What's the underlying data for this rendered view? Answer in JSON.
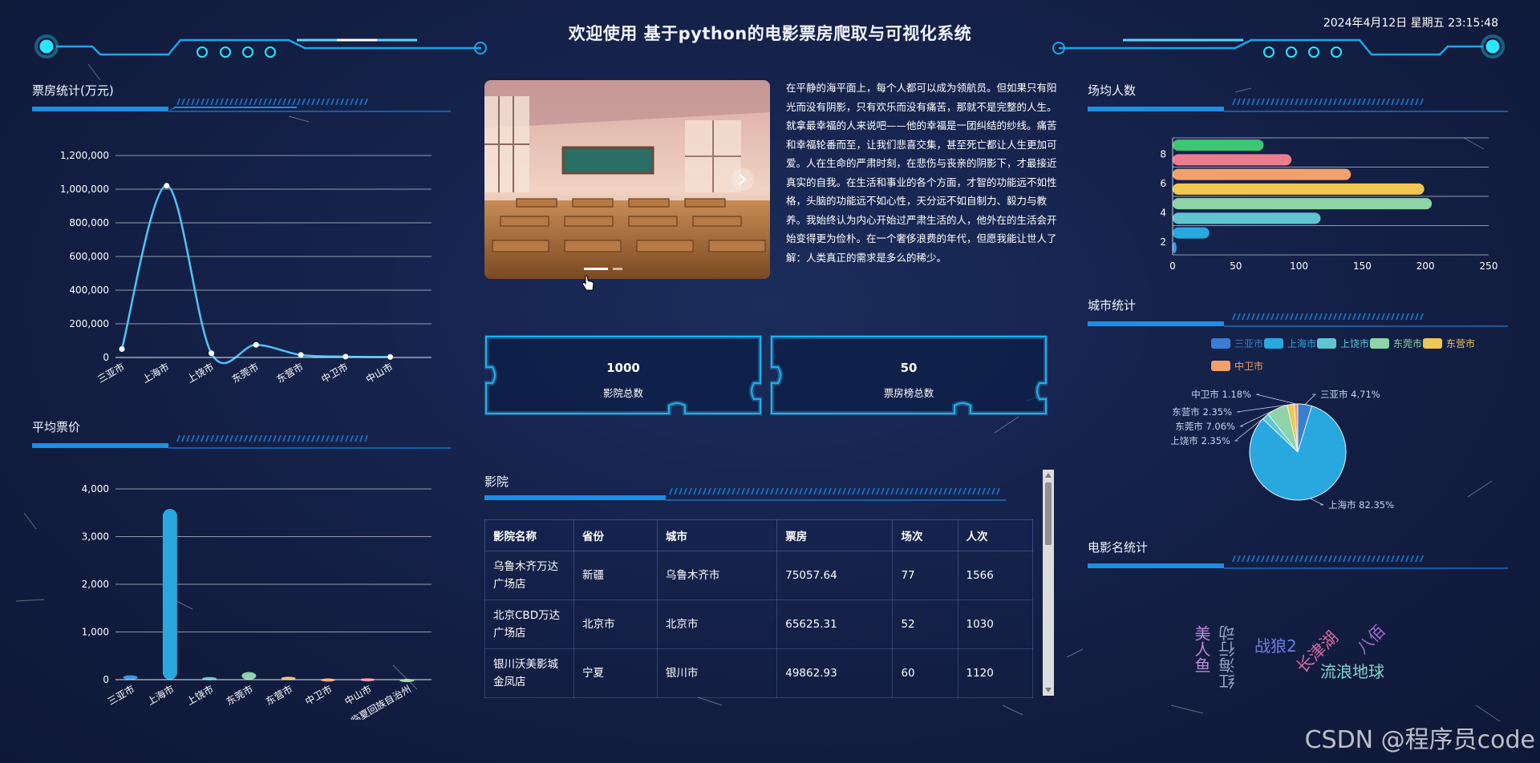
{
  "header": {
    "title": "欢迎使用 基于python的电影票房爬取与可视化系统",
    "datetime": "2024年4月12日 星期五 23:15:48"
  },
  "panels": {
    "box_office": {
      "title": "票房统计(万元)"
    },
    "avg_price": {
      "title": "平均票价"
    },
    "avg_attendance": {
      "title": "场均人数"
    },
    "city_stats": {
      "title": "城市统计"
    },
    "movie_names": {
      "title": "电影名统计"
    },
    "cinema": {
      "title": "影院"
    }
  },
  "intro_text": "在平静的海平面上，每个人都可以成为领航员。但如果只有阳光而没有阴影，只有欢乐而没有痛苦，那就不是完整的人生。就拿最幸福的人来说吧——他的幸福是一团纠结的纱线。痛苦和幸福轮番而至，让我们悲喜交集，甚至死亡都让人生更加可爱。人在生命的严肃时刻，在悲伤与丧亲的阴影下，才最接近真实的自我。在生活和事业的各个方面，才智的功能远不如性格，头脑的功能远不如心性，天分远不如自制力、毅力与教养。我始终认为内心开始过严肃生活的人，他外在的生活会开始变得更为俭朴。在一个奢侈浪费的年代，但愿我能让世人了解：人类真正的需求是多么的稀少。",
  "stats": {
    "cinema_total": {
      "value": "1000",
      "label": "影院总数"
    },
    "board_total": {
      "value": "50",
      "label": "票房榜总数"
    }
  },
  "cinema_table": {
    "headers": [
      "影院名称",
      "省份",
      "城市",
      "票房",
      "场次",
      "人次"
    ],
    "rows": [
      [
        "乌鲁木齐万达广场店",
        "新疆",
        "乌鲁木齐市",
        "75057.64",
        "77",
        "1566"
      ],
      [
        "北京CBD万达广场店",
        "北京市",
        "北京市",
        "65625.31",
        "52",
        "1030"
      ],
      [
        "银川沃美影城金凤店",
        "宁夏",
        "银川市",
        "49862.93",
        "60",
        "1120"
      ]
    ]
  },
  "word_cloud": [
    {
      "text": "美人鱼",
      "color": "#b98ad8"
    },
    {
      "text": "红海行动",
      "color": "#9aa3c4"
    },
    {
      "text": "战狼2",
      "color": "#6b7fe0"
    },
    {
      "text": "长津湖",
      "color": "#d46aa4"
    },
    {
      "text": "八佰",
      "color": "#a56bd6"
    },
    {
      "text": "流浪地球",
      "color": "#7fd6d0"
    }
  ],
  "watermark": "CSDN @程序员code",
  "chart_data": [
    {
      "id": "box_office",
      "type": "line",
      "categories": [
        "三亚市",
        "上海市",
        "上饶市",
        "东莞市",
        "东营市",
        "中卫市",
        "中山市"
      ],
      "values": [
        50000,
        1020000,
        25000,
        75000,
        15000,
        5000,
        3000
      ],
      "ylim": [
        0,
        1200000
      ],
      "yticks": [
        "0",
        "200,000",
        "400,000",
        "600,000",
        "800,000",
        "1,000,000",
        "1,200,000"
      ],
      "color": "#4fc3f7",
      "grid": true
    },
    {
      "id": "avg_price",
      "type": "bar",
      "categories": [
        "三亚市",
        "上海市",
        "上饶市",
        "东莞市",
        "东营市",
        "中卫市",
        "中山市",
        "临夏回族自治州"
      ],
      "values": [
        90,
        3580,
        55,
        160,
        60,
        25,
        30,
        15
      ],
      "colors": [
        "#3b9be0",
        "#29a8e0",
        "#5fc5d0",
        "#8fd3a8",
        "#e8c45e",
        "#e89a6a",
        "#e07a9a",
        "#9bd5a0"
      ],
      "ylim": [
        0,
        4000
      ],
      "yticks": [
        "0",
        "1,000",
        "2,000",
        "3,000",
        "4,000"
      ],
      "grid": true
    },
    {
      "id": "avg_attendance",
      "type": "bar",
      "orientation": "horizontal",
      "y_tick_labels": [
        "2",
        "4",
        "6",
        "8"
      ],
      "values": [
        3,
        29,
        117,
        205,
        199,
        141,
        94,
        72
      ],
      "colors": [
        "#3b9be0",
        "#29a8e0",
        "#5fc5d0",
        "#8fd3a8",
        "#f0c750",
        "#f2a06a",
        "#ec7d8e",
        "#3cc774"
      ],
      "xlim": [
        0,
        250
      ],
      "xticks": [
        "0",
        "50",
        "100",
        "150",
        "200",
        "250"
      ],
      "grid": true
    },
    {
      "id": "city_stats",
      "type": "pie",
      "legend": [
        "三亚市",
        "上海市",
        "上饶市",
        "东莞市",
        "东营市",
        "中卫市"
      ],
      "legend_colors": [
        "#3b7dd0",
        "#29a8e0",
        "#5fc5d0",
        "#8fd3a8",
        "#f0c750",
        "#f2a06a"
      ],
      "slices": [
        {
          "name": "三亚市",
          "value": 4.71,
          "label": "三亚市 4.71%",
          "color": "#3b7dd0"
        },
        {
          "name": "上海市",
          "value": 82.35,
          "label": "上海市 82.35%",
          "color": "#29a8e0"
        },
        {
          "name": "上饶市",
          "value": 2.35,
          "label": "上饶市 2.35%",
          "color": "#5fc5d0"
        },
        {
          "name": "东莞市",
          "value": 7.06,
          "label": "东莞市 7.06%",
          "color": "#8fd3a8"
        },
        {
          "name": "东营市",
          "value": 2.35,
          "label": "东营市 2.35%",
          "color": "#f0c750"
        },
        {
          "name": "中卫市",
          "value": 1.18,
          "label": "中卫市 1.18%",
          "color": "#f2a06a"
        }
      ],
      "legend_placement": "top"
    }
  ]
}
